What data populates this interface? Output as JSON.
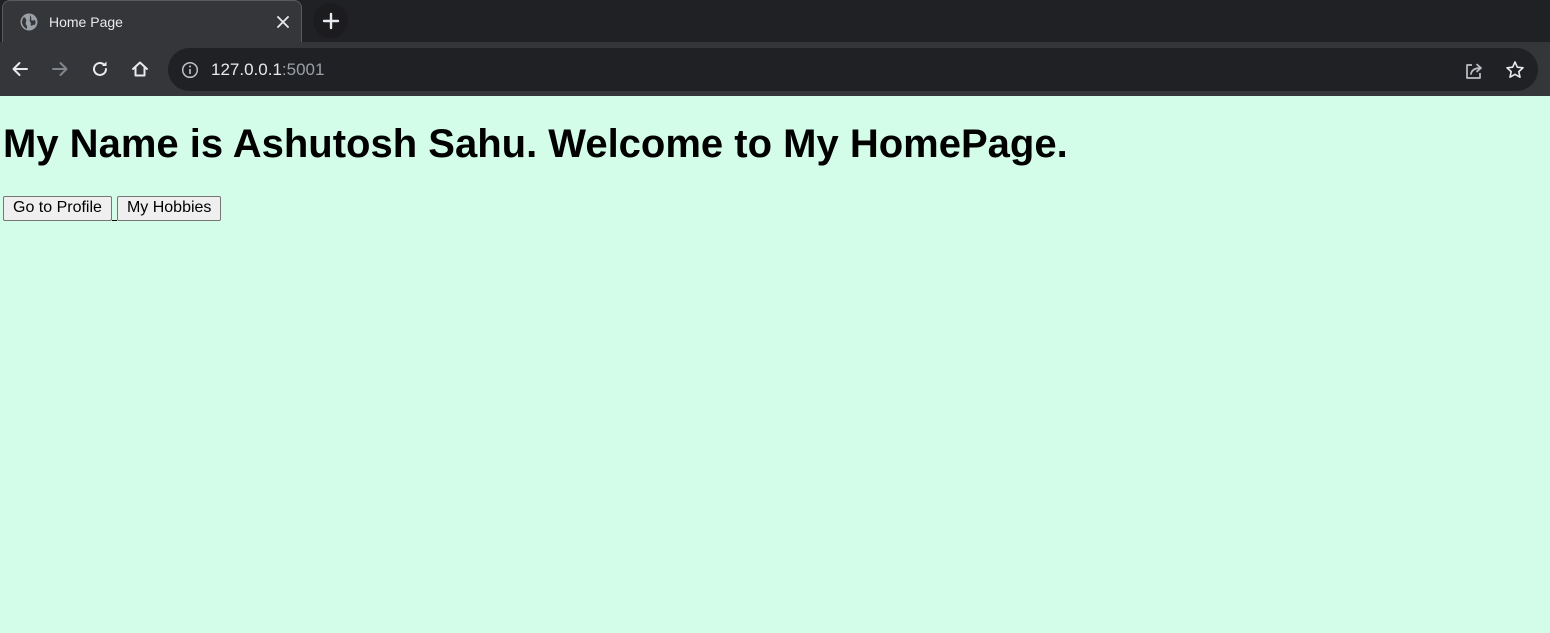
{
  "browser": {
    "tab": {
      "title": "Home Page",
      "favicon_icon": "globe-icon",
      "close_icon": "close-icon"
    },
    "new_tab_icon": "plus-icon",
    "toolbar": {
      "back_icon": "arrow-left-icon",
      "forward_icon": "arrow-right-icon",
      "reload_icon": "reload-icon",
      "home_icon": "home-icon"
    },
    "omnibox": {
      "info_icon": "info-icon",
      "url_host": "127.0.0.1",
      "url_port": ":5001",
      "share_icon": "share-icon",
      "star_icon": "star-icon"
    },
    "colors": {
      "tabstrip_bg": "#202124",
      "toolbar_bg": "#35363a",
      "omnibox_bg": "#202124"
    }
  },
  "page": {
    "background_color": "#d4fde9",
    "heading": "My Name is Ashutosh Sahu. Welcome to My HomePage.",
    "buttons": {
      "profile_label": "Go to Profile",
      "hobbies_label": "My Hobbies"
    }
  }
}
